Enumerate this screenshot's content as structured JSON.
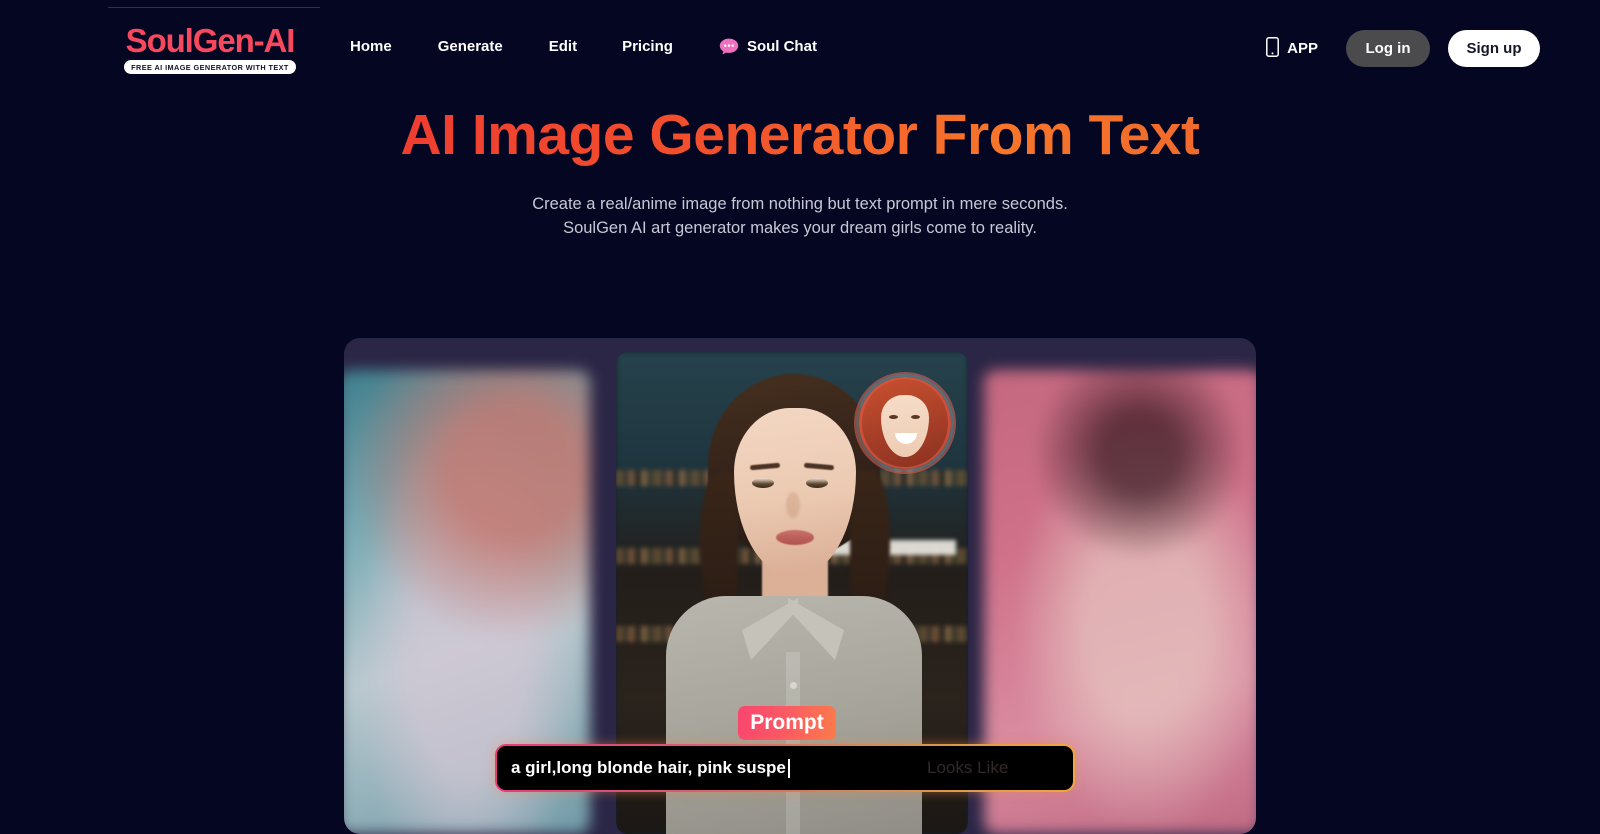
{
  "brand": {
    "name": "SoulGen-AI",
    "tagline": "FREE AI IMAGE GENERATOR WITH TEXT",
    "color": "#f8485e"
  },
  "nav": {
    "items": [
      {
        "label": "Home"
      },
      {
        "label": "Generate"
      },
      {
        "label": "Edit"
      },
      {
        "label": "Pricing"
      },
      {
        "label": "Soul Chat",
        "icon": "chat-bubble-icon",
        "icon_color": "#ef6fc0"
      }
    ]
  },
  "header_actions": {
    "app_label": "APP",
    "app_icon": "mobile-phone-icon",
    "login_label": "Log in",
    "signup_label": "Sign up",
    "login_bg": "#4b4b4e",
    "signup_bg": "#ffffff"
  },
  "hero": {
    "title": "AI Image Generator From Text",
    "title_gradient_from": "#ef3d30",
    "title_gradient_to": "#f7762a",
    "subtitle_line1": "Create a real/anime image from nothing but text prompt in mere seconds.",
    "subtitle_line2": "SoulGen AI art generator makes your dream girls come to reality."
  },
  "carousel": {
    "background": "#2b2646",
    "prompt_badge": "Prompt",
    "prompt_badge_gradient_from": "#f9466f",
    "prompt_badge_gradient_to": "#fb7b4c",
    "prompt_value": "a girl,long blonde hair, pink suspe",
    "prompt_ghost": "Looks Like",
    "input_border_from": "#e8397f",
    "input_border_to": "#f2a63c"
  },
  "page": {
    "background": "#040622"
  }
}
